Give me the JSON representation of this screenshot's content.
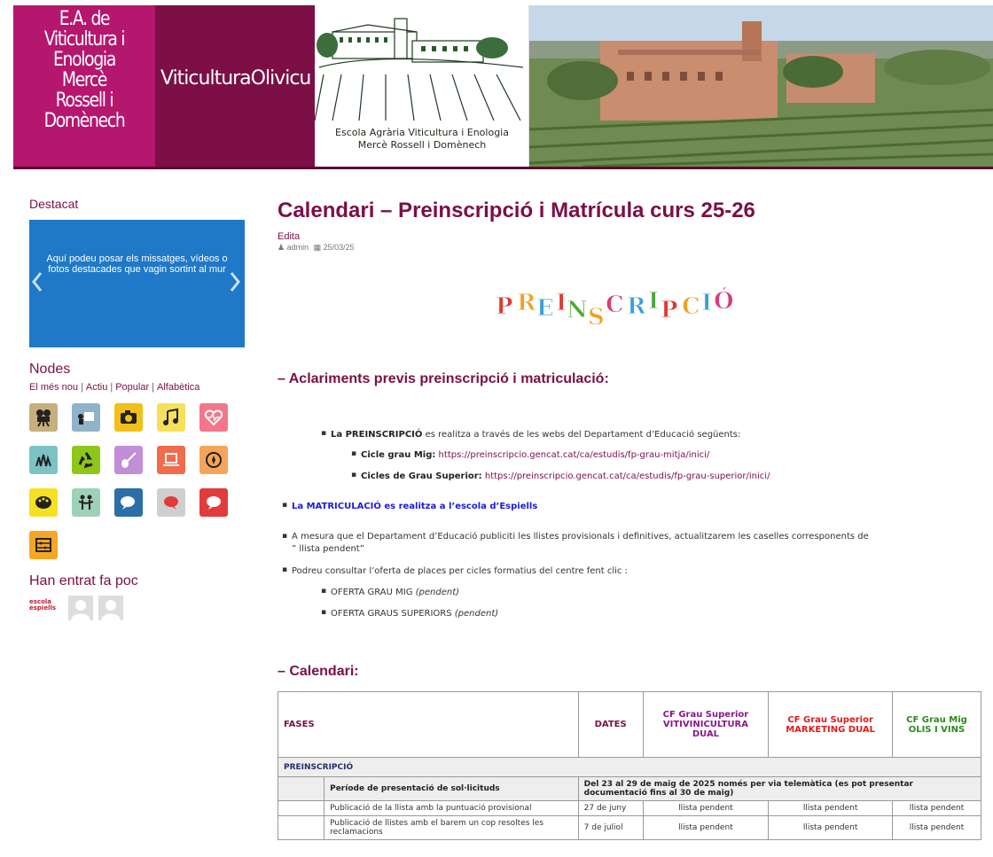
{
  "header": {
    "school_name_lines": [
      "E.A. de",
      "Viticultura i",
      "Enologia",
      "Mercè",
      "Rossell i",
      "Domènech"
    ],
    "site_name": "ViticulturaOlivicu",
    "logo_line1": "Escola Agrària Viticultura i Enologia",
    "logo_line2": "Mercè Rossell i Domènech"
  },
  "sidebar": {
    "featured_heading": "Destacat",
    "featured_text": "Aquí podeu posar els missatges, vídeos o fotos destacades que vagin sortint al mur",
    "nodes_heading": "Nodes",
    "node_tabs": [
      "El més nou",
      "Actiu",
      "Popular",
      "Alfabètica"
    ],
    "node_icons": [
      {
        "icon": "film-camera-icon",
        "color": "#c8b07e"
      },
      {
        "icon": "projector-icon",
        "color": "#8fb3c8"
      },
      {
        "icon": "camera-icon",
        "color": "#f3c01a"
      },
      {
        "icon": "music-icon",
        "color": "#f6e05a"
      },
      {
        "icon": "heartbeat-icon",
        "color": "#f2778b"
      },
      {
        "icon": "plants-icon",
        "color": "#7dc2c5"
      },
      {
        "icon": "recycle-icon",
        "color": "#8ec61a"
      },
      {
        "icon": "guitar-icon",
        "color": "#c28ed6"
      },
      {
        "icon": "laptop-icon",
        "color": "#f26b4a"
      },
      {
        "icon": "compass-icon",
        "color": "#f5a55a"
      },
      {
        "icon": "palette-icon",
        "color": "#f6e024"
      },
      {
        "icon": "people-icon",
        "color": "#9ed1b6"
      },
      {
        "icon": "chat-icon",
        "color": "#2b6ea8"
      },
      {
        "icon": "chat-red-icon",
        "color": "#cfcfcf"
      },
      {
        "icon": "chat-bubble-icon",
        "color": "#e23b3b"
      },
      {
        "icon": "abacus-icon",
        "color": "#f5a623"
      }
    ],
    "recent_heading": "Han entrat fa poc",
    "recent_logo_text": [
      "escola",
      "espiells"
    ]
  },
  "post": {
    "title": "Calendari – Preinscripció i Matrícula curs 25-26",
    "edit": "Edita",
    "author": "admin",
    "date": "25/03/25",
    "banner_letters": [
      "P",
      "R",
      "E",
      "I",
      "N",
      "S",
      "C",
      "R",
      "I",
      "P",
      "C",
      "I",
      "Ó"
    ],
    "section1_heading": "– Aclariments previs preinscripció i matriculació:",
    "b1_bold": "La PREINSCRIPCIÓ",
    "b1_rest": " es realitza a través de les webs del Departament d’Educació següents",
    "b1_colon": ":",
    "b1a_label": "Cicle grau Mig:",
    "b1a_url": " https://preinscripcio.gencat.cat/ca/estudis/fp-grau-mitja/inici/",
    "b1b_label": "Cicles de Grau Superior:",
    "b1b_url": "  https://preinscripcio.gencat.cat/ca/estudis/fp-grau-superior/inici/",
    "b2": "La MATRICULACIÓ es realitza a l’escola d’Espiells",
    "b3_line1": "A mesura que el Departament d’Educació publiciti les llistes provisionals i definitives, actualitzarem les caselles corresponents de",
    "b3_line2": "” llista pendent”",
    "b4": "Podreu consultar l’oferta de places per cicles formatius del centre fent clic :",
    "b4a_text": "OFERTA GRAU MIG ",
    "b4a_italic": "(pendent)",
    "b4b_text": "OFERTA GRAUS SUPERIORS ",
    "b4b_italic": "(pendent)",
    "section2_heading": "– Calendari:"
  },
  "table": {
    "headers": {
      "fases": "FASES",
      "dates": "DATES",
      "col1": "CF Grau Superior VITIVINICULTURA DUAL",
      "col2": "CF Grau Superior MARKETING DUAL",
      "col3": "CF Grau Mig OLIS I VINS"
    },
    "section_row": "PREINSCRIPCIÓ",
    "period_label": "Període de presentació de sol·licituds",
    "period_dates": "Del 23 al 29 de maig de 2025 només per via telemàtica (es pot presentar documentació fins al 30 de maig)",
    "rows": [
      {
        "label": "Publicació de la llista amb la puntuació provisional",
        "date": "27 de juny",
        "c1": "llista pendent",
        "c2": "llista pendent",
        "c3": "llista pendent"
      },
      {
        "label": "Publicació de llistes amb el barem un cop resoltes les reclamacions",
        "date": "7 de juliol",
        "c1": "llista pendent",
        "c2": "llista pendent",
        "c3": "llista pendent"
      }
    ]
  }
}
